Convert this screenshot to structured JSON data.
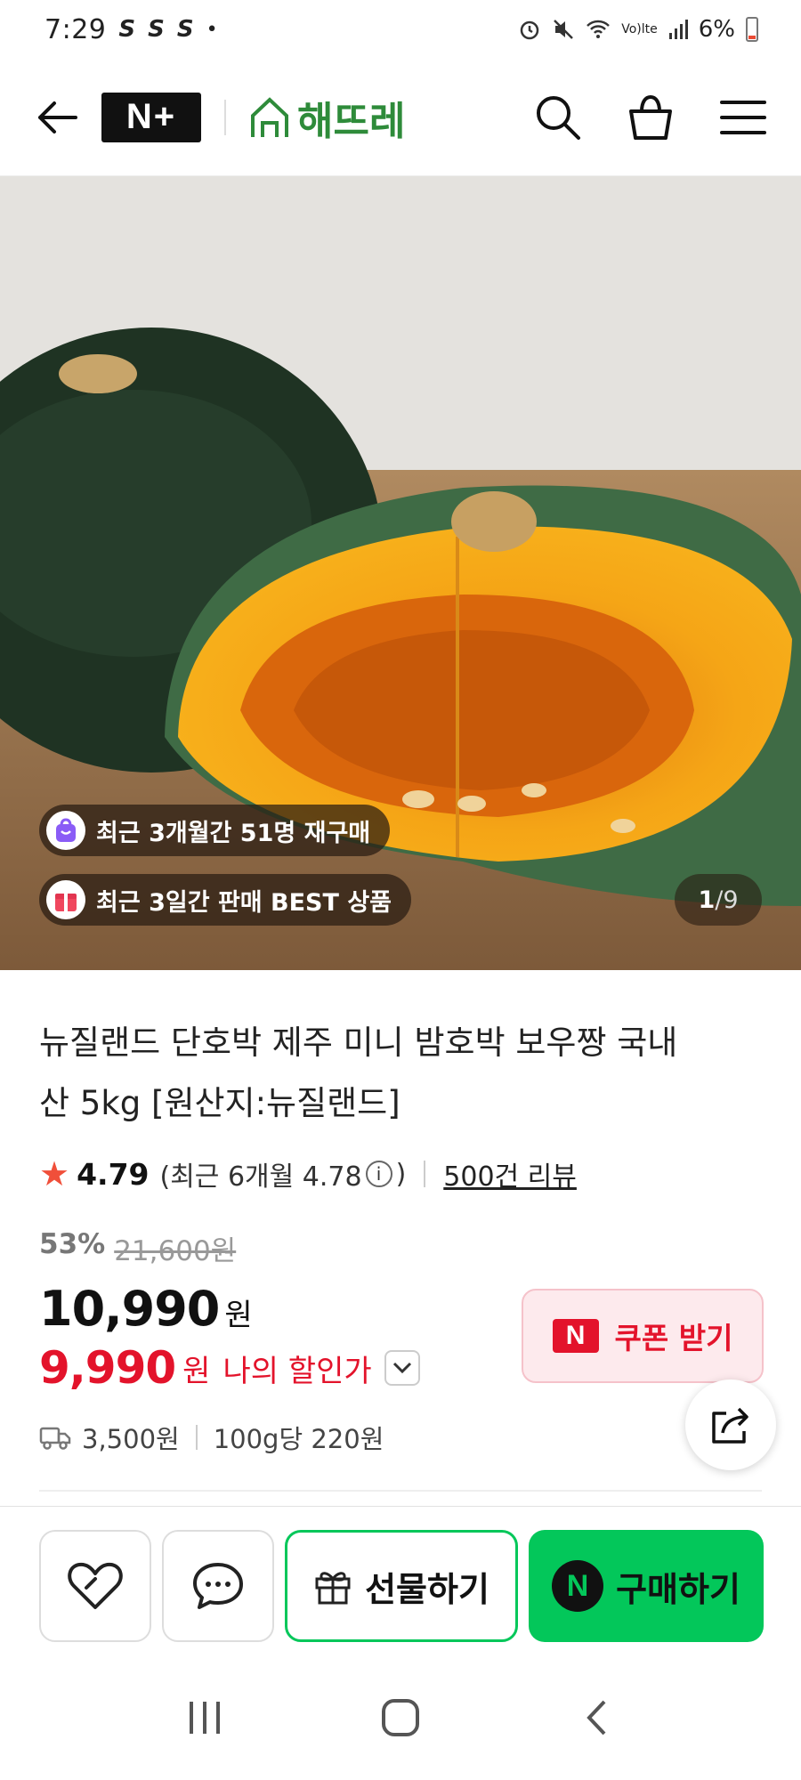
{
  "status_bar": {
    "time": "7:29",
    "notif_icons": [
      "S",
      "S",
      "S"
    ],
    "dot": "•",
    "network": "Vo)lte",
    "battery": "6%"
  },
  "header": {
    "nplus_label": "N+",
    "brand_name": "해뜨레"
  },
  "gallery": {
    "badge_repurchase": "최근 3개월간 51명 재구매",
    "badge_best": "최근 3일간 판매 BEST 상품",
    "current_index": "1",
    "separator": "/",
    "total": "9"
  },
  "product": {
    "title": "뉴질랜드 단호박 제주 미니 밤호박 보우짱 국내산 5kg [원산지:뉴질랜드]",
    "rating": "4.79",
    "recent_rating_prefix": "(최근 6개월 4.78",
    "recent_rating_suffix": ")",
    "review_count": "500건 리뷰",
    "discount_pct": "53%",
    "original_price": "21,600원",
    "price": "10,990",
    "price_unit": "원",
    "my_price": "9,990",
    "my_price_unit": "원",
    "my_price_label": "나의 할인가",
    "shipping_fee": "3,500원",
    "unit_price": "100g당 220원"
  },
  "coupon": {
    "icon_label": "N",
    "label": "쿠폰 받기"
  },
  "actions": {
    "gift_label": "선물하기",
    "buy_label": "구매하기",
    "buy_icon": "N"
  },
  "colors": {
    "naver_green": "#03c75a",
    "price_red": "#e3132b",
    "brand_green": "#2e8b3a",
    "star": "#f04f3a"
  }
}
